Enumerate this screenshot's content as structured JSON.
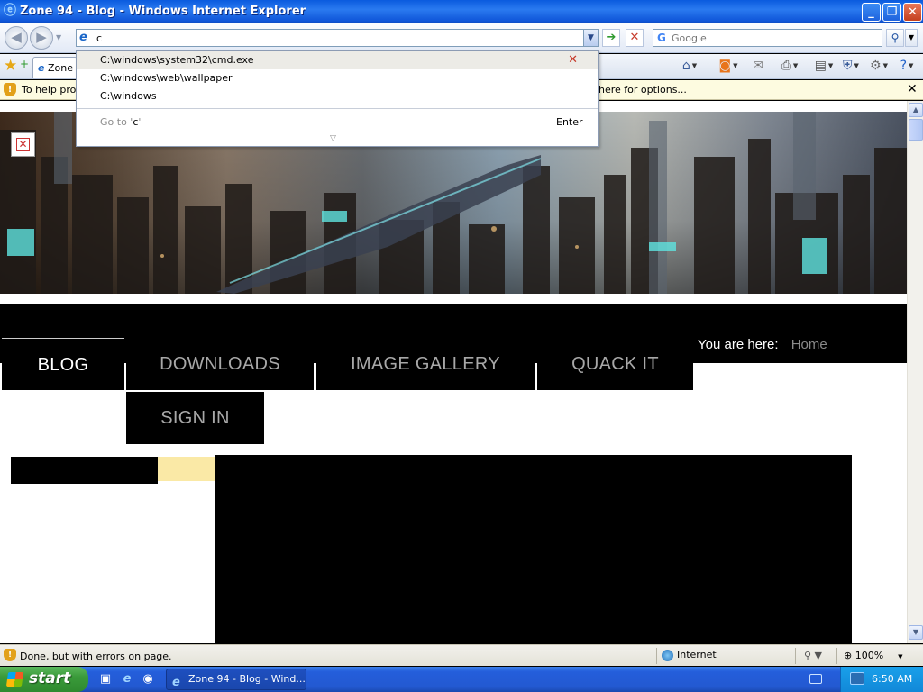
{
  "window": {
    "title": "Zone 94 - Blog - Windows Internet Explorer",
    "minimize": "_",
    "maximize": "❐",
    "close": "✕"
  },
  "navbar": {
    "back": "◀",
    "forward": "▶",
    "address_value": "c",
    "search_placeholder": "Google",
    "go_icon": "go-arrow-icon",
    "stop_icon": "stop-x-icon"
  },
  "autocomplete": {
    "items": [
      "C:\\windows\\system32\\cmd.exe",
      "C:\\windows\\web\\wallpaper",
      "C:\\windows"
    ],
    "goto_prefix": "Go to '",
    "goto_value": "c",
    "goto_suffix": "'",
    "enter": "Enter"
  },
  "tabbar": {
    "tab_label": "Zone 94 - Blog"
  },
  "infobar": {
    "message_left": "To help prote",
    "message_right": "here for options..."
  },
  "site": {
    "nav": [
      "BLOG",
      "DOWNLOADS",
      "IMAGE GALLERY",
      "QUACK IT",
      "SIGN IN"
    ],
    "crumb_label": "You are here:",
    "crumb_home": "Home"
  },
  "statusbar": {
    "text": "Done, but with errors on page.",
    "zone": "Internet",
    "zoom": "100%"
  },
  "taskbar": {
    "start": "start",
    "task_item": "Zone 94 - Blog - Wind...",
    "clock": "6:50 AM"
  },
  "colors": {
    "titlebar": "#0a5bde",
    "start_green": "#3a9a3a",
    "tray_blue": "#1288d8",
    "infobar_yellow": "#fdfbe0",
    "highlight_yellow": "#fae9a6"
  }
}
